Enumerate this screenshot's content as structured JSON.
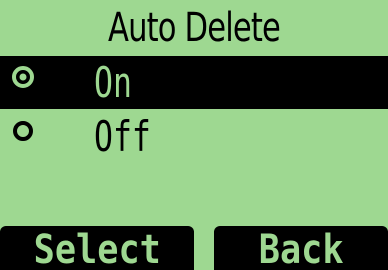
{
  "screen": {
    "title": "Auto Delete",
    "options": [
      {
        "label": "On",
        "selected": true
      },
      {
        "label": "Off",
        "selected": false
      }
    ]
  },
  "softkeys": {
    "left_label": "Select",
    "right_label": "Back"
  },
  "colors": {
    "background": "#9ed891",
    "foreground": "#000000"
  },
  "icons": {
    "radio_selected": "radio-selected-icon",
    "radio_unselected": "radio-unselected-icon"
  }
}
